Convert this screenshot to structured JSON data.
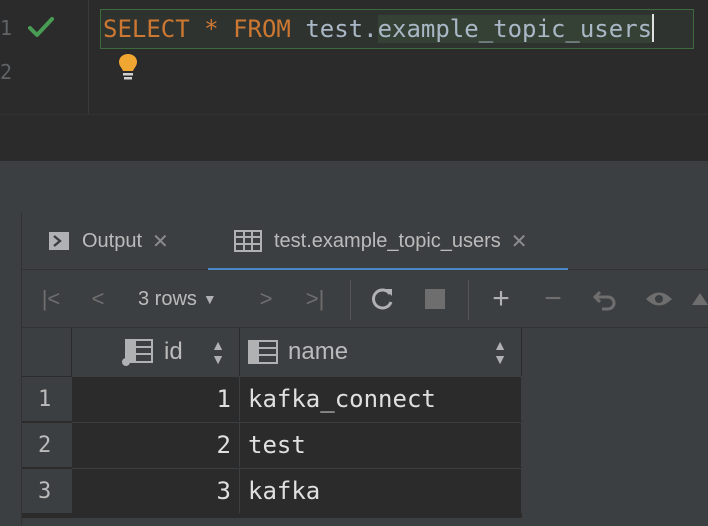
{
  "editor": {
    "gutter": [
      "1",
      "2"
    ],
    "query": {
      "kw1": "SELECT",
      "star": "*",
      "kw2": "FROM",
      "schema": "test.",
      "table": "example_topic_users"
    },
    "status_icon": "check-icon",
    "hint_icon": "lightbulb-icon"
  },
  "panel": {
    "tabs": [
      {
        "label": "Output",
        "icon": "console-icon",
        "active": false
      },
      {
        "label": "test.example_topic_users",
        "icon": "table-icon",
        "active": true
      }
    ],
    "toolbar": {
      "rows_label": "3 rows",
      "icons": [
        "first-page-icon",
        "prev-page-icon",
        "next-page-icon",
        "last-page-icon",
        "refresh-icon",
        "stop-icon",
        "add-row-icon",
        "delete-row-icon",
        "revert-icon",
        "view-icon"
      ]
    }
  },
  "grid": {
    "columns": [
      {
        "name": "id",
        "icon": "key-column-icon"
      },
      {
        "name": "name",
        "icon": "column-icon"
      }
    ],
    "rows": [
      {
        "num": "1",
        "id": "1",
        "name": "kafka_connect"
      },
      {
        "num": "2",
        "id": "2",
        "name": "test"
      },
      {
        "num": "3",
        "id": "3",
        "name": "kafka"
      }
    ]
  },
  "colors": {
    "keyword": "#cc7832",
    "accent": "#4a88c7",
    "success": "#499c54"
  }
}
